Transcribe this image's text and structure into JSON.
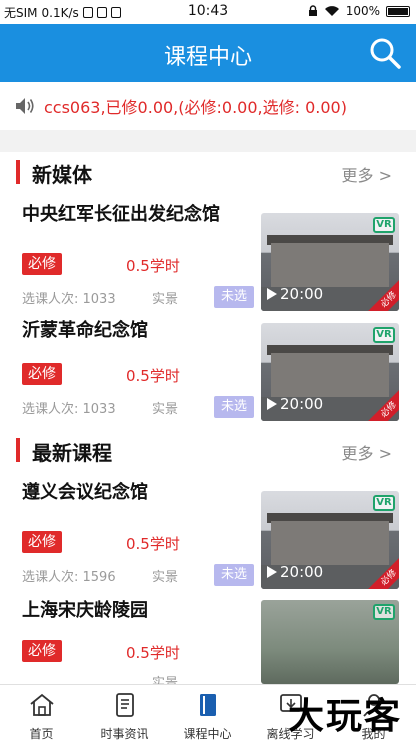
{
  "status_bar": {
    "carrier": "无SIM",
    "speed": "0.1K/s",
    "time": "10:43",
    "battery": "100%"
  },
  "header": {
    "title": "课程中心"
  },
  "notice": {
    "text": "ccs063,已修0.00,(必修:0.00,选修: 0.00)"
  },
  "sections": [
    {
      "title": "新媒体",
      "more": "更多 >",
      "courses": [
        {
          "title": "中央红军长征出发纪念馆",
          "tag": "必修",
          "hours": "0.5学时",
          "enroll": "选课人次: 1033",
          "type": "实景",
          "status": "未选",
          "duration": "20:00",
          "corner": "必修"
        },
        {
          "title": "沂蒙革命纪念馆",
          "tag": "必修",
          "hours": "0.5学时",
          "enroll": "选课人次: 1033",
          "type": "实景",
          "status": "未选",
          "duration": "20:00",
          "corner": "必修"
        }
      ]
    },
    {
      "title": "最新课程",
      "more": "更多 >",
      "courses": [
        {
          "title": "遵义会议纪念馆",
          "tag": "必修",
          "hours": "0.5学时",
          "enroll": "选课人次: 1596",
          "type": "实景",
          "status": "未选",
          "duration": "20:00",
          "corner": "必修"
        },
        {
          "title": "上海宋庆龄陵园",
          "tag": "必修",
          "hours": "0.5学时",
          "enroll": "",
          "type": "实景",
          "status": "",
          "duration": "",
          "corner": ""
        }
      ]
    }
  ],
  "tabbar": {
    "items": [
      {
        "label": "首页",
        "icon": "home-icon"
      },
      {
        "label": "时事资讯",
        "icon": "document-icon"
      },
      {
        "label": "课程中心",
        "icon": "book-icon",
        "active": true
      },
      {
        "label": "离线学习",
        "icon": "download-icon"
      },
      {
        "label": "我的",
        "icon": "user-icon"
      }
    ]
  },
  "watermark": "大玩客",
  "colors": {
    "brand_blue": "#1a8fe0",
    "accent_red": "#e02a2a",
    "unselected_purple": "#b7b8ee",
    "vr_green": "#1fa36b"
  }
}
